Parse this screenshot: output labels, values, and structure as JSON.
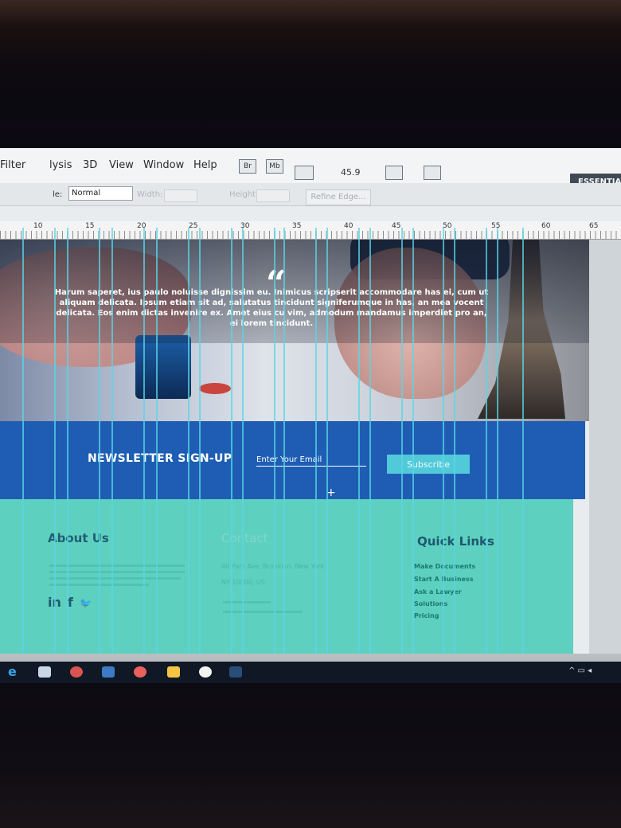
{
  "menubar": {
    "items": [
      "Filter",
      "lysis",
      "3D",
      "View",
      "Window",
      "Help"
    ],
    "icons": [
      "Br",
      "Mb"
    ],
    "zoom": "45.9",
    "workspace": "ESSENTIA"
  },
  "options": {
    "style_label": "le:",
    "style_value": "Normal",
    "width_label": "Width:",
    "height_label": "Height:",
    "refine_edge": "Refine Edge..."
  },
  "ruler": {
    "numbers": [
      "10",
      "15",
      "20",
      "25",
      "30",
      "35",
      "40",
      "45",
      "50",
      "55",
      "60",
      "65"
    ]
  },
  "hero": {
    "quote_mark": "“",
    "quote_text": "Harum saperet, ius paulo noluisse dignissim eu. Inimicus scripserit accommodare has ei, cum ut aliquam delicata. Ipsum etiam sit ad, salutatus tincidunt signiferumque in has, an mea vocent delicata. Eos enim dictas invenire ex. Amet eius cu vim, admodum mandamus imperdiet pro an, ei lorem tincidunt."
  },
  "newsletter": {
    "title": "NEWSLETTER SIGN-UP",
    "placeholder": "Enter Your Email",
    "button": "Subscribe"
  },
  "footer": {
    "about_title": "About Us",
    "contact_title": "Contact",
    "contact_address": "40 Park Ave, Brooklyn, New York",
    "contact_zip": "NY 10000, US",
    "quick_title": "Quick Links",
    "quick_links": [
      "Make Documents",
      "Start A Business",
      "Ask a Lawyer",
      "Solutions",
      "Pricing"
    ]
  },
  "colors": {
    "newsletter_bg": "#1e5db3",
    "footer_bg": "#5ed0bf",
    "button_bg": "#52c9d8",
    "guide": "#5ad6e6"
  }
}
